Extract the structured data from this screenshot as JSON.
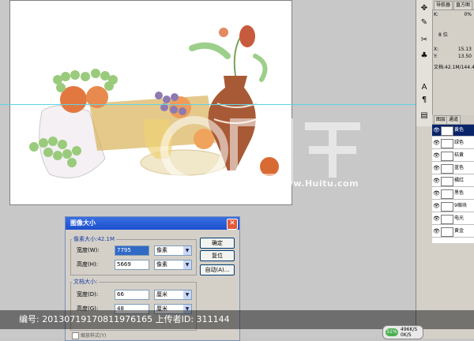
{
  "canvas": {
    "description_icon": "still-life-painting"
  },
  "dock": {
    "top_tabs": [
      "导航器",
      "直方图"
    ],
    "info": {
      "k_label": "K:",
      "k_value": "0%",
      "bits": "8 位",
      "x_label": "X:",
      "x_value": "15.13",
      "y_label": "Y:",
      "y_value": "13.50",
      "doc": "文档:42.1M/144.4"
    },
    "layers_tabs": [
      "图层",
      "通道"
    ],
    "layers": [
      {
        "name": "黄色",
        "selected": true
      },
      {
        "name": "绿色",
        "selected": false
      },
      {
        "name": "桔黄",
        "selected": false
      },
      {
        "name": "蓝色",
        "selected": false
      },
      {
        "name": "橘红",
        "selected": false
      },
      {
        "name": "黑色",
        "selected": false
      },
      {
        "name": "9缩块",
        "selected": false
      },
      {
        "name": "电光",
        "selected": false
      },
      {
        "name": "黄金",
        "selected": false
      }
    ],
    "status_percent": "51%",
    "status_speed": "496K/S",
    "status_speed2": "0K/S"
  },
  "dialog": {
    "title": "图像大小",
    "pixel_group": "像素大小:42.1M",
    "width_label": "宽度(W):",
    "width_value": "7795",
    "width_unit": "像素",
    "height_label": "高度(H):",
    "height_value": "5669",
    "height_unit": "像素",
    "doc_group": "文档大小:",
    "doc_width_label": "宽度(D):",
    "doc_width_value": "66",
    "doc_width_unit": "厘米",
    "doc_height_label": "高度(G):",
    "doc_height_value": "48",
    "doc_height_unit": "厘米",
    "scale_styles": "缩放样式(Y)",
    "ok": "确定",
    "reset": "复位",
    "auto": "自动(A)...",
    "close_icon": "close-icon"
  },
  "watermark": {
    "text": "编号: 20130719170811976165 上传者ID: 311144",
    "site": "www.Huitu.com"
  },
  "colors": {
    "guide": "#5fd3e6",
    "titlebar": "#1c4fd0",
    "selected_layer": "#0a246a"
  }
}
